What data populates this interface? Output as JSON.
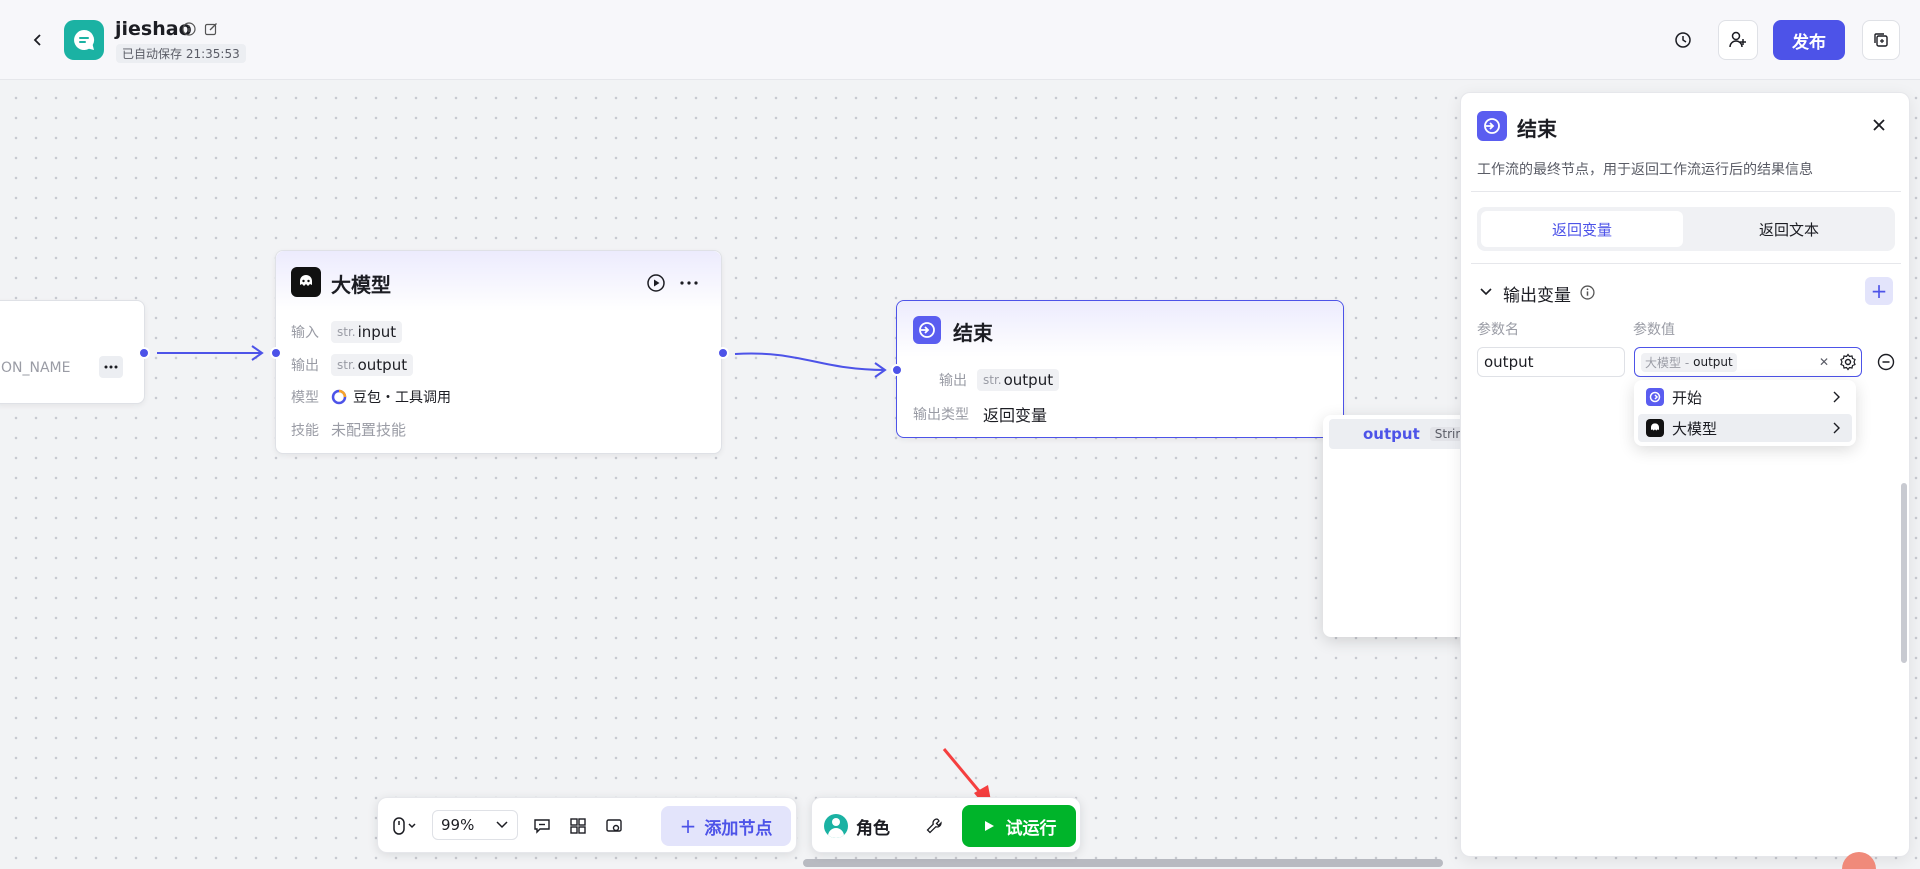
{
  "header": {
    "app_name": "jieshao",
    "autosave": "已自动保存 21:35:53",
    "publish_label": "发布"
  },
  "nodes": {
    "left_partial": {
      "text": "ON_NAME"
    },
    "llm": {
      "title": "大模型",
      "input_label": "输入",
      "input_type": "str.",
      "input_value": "input",
      "output_label": "输出",
      "output_type": "str.",
      "output_value": "output",
      "model_label": "模型",
      "model_value": "豆包・工具调用",
      "skill_label": "技能",
      "skill_value": "未配置技能"
    },
    "end": {
      "title": "结束",
      "output_label": "输出",
      "output_type": "str.",
      "output_value": "output",
      "output_kind_label": "输出类型",
      "output_kind_value": "返回变量"
    }
  },
  "panel": {
    "title": "结束",
    "description": "工作流的最终节点，用于返回工作流运行后的结果信息",
    "tabs": [
      "返回变量",
      "返回文本"
    ],
    "section_title": "输出变量",
    "col_name": "参数名",
    "col_value": "参数值",
    "param_name": "output",
    "param_value_source": "大模型 -",
    "param_value_var": "output"
  },
  "dropdown": {
    "items": [
      "开始",
      "大模型"
    ],
    "sub_items": [
      {
        "name": "output",
        "type": "String"
      }
    ]
  },
  "toolbar": {
    "zoom": "99%",
    "add_node_label": "添加节点",
    "role_label": "角色",
    "run_label": "试运行"
  },
  "colors": {
    "accent": "#4d53e8",
    "run_green": "#00b42a",
    "annotation_arrow": "#f53f3f"
  }
}
